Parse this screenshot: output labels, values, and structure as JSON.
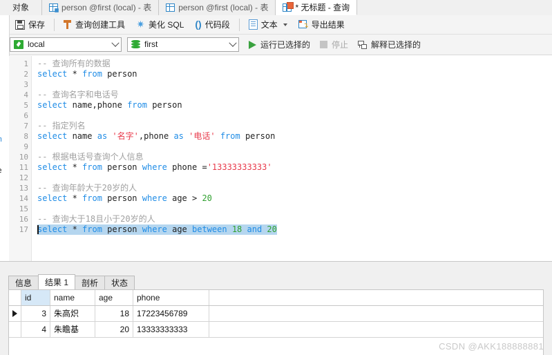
{
  "window": {
    "tabs": [
      {
        "label": "对象",
        "icon": "none",
        "state": "inactive"
      },
      {
        "label": "person @first (local) - 表",
        "icon": "table-edit-icon",
        "state": "inactive"
      },
      {
        "label": "person @first (local) - 表",
        "icon": "table-icon",
        "state": "inactive"
      },
      {
        "label": "* 无标题 - 查询",
        "icon": "query-icon",
        "state": "active"
      }
    ]
  },
  "toolbar": {
    "save_label": "保存",
    "query_builder_label": "查询创建工具",
    "beautify_label": "美化 SQL",
    "snippet_label": "代码段",
    "text_label": "文本",
    "export_label": "导出结果"
  },
  "selectors": {
    "connection_value": "local",
    "database_value": "first",
    "run_selected_label": "运行已选择的",
    "stop_label": "停止",
    "explain_selected_label": "解释已选择的"
  },
  "editor": {
    "lines": [
      {
        "n": "1",
        "tokens": [
          {
            "t": "cmt",
            "v": "-- 查询所有的数据"
          }
        ]
      },
      {
        "n": "2",
        "tokens": [
          {
            "t": "kw",
            "v": "select"
          },
          {
            "t": "op",
            "v": " * "
          },
          {
            "t": "kw",
            "v": "from"
          },
          {
            "t": "id",
            "v": " person"
          }
        ]
      },
      {
        "n": "3",
        "tokens": []
      },
      {
        "n": "4",
        "tokens": [
          {
            "t": "cmt",
            "v": "-- 查询名字和电话号"
          }
        ]
      },
      {
        "n": "5",
        "tokens": [
          {
            "t": "kw",
            "v": "select"
          },
          {
            "t": "id",
            "v": " name"
          },
          {
            "t": "op",
            "v": ","
          },
          {
            "t": "id",
            "v": "phone "
          },
          {
            "t": "kw",
            "v": "from"
          },
          {
            "t": "id",
            "v": " person"
          }
        ]
      },
      {
        "n": "6",
        "tokens": []
      },
      {
        "n": "7",
        "tokens": [
          {
            "t": "cmt",
            "v": "-- 指定列名"
          }
        ]
      },
      {
        "n": "8",
        "tokens": [
          {
            "t": "kw",
            "v": "select"
          },
          {
            "t": "id",
            "v": " name "
          },
          {
            "t": "kw",
            "v": "as"
          },
          {
            "t": "op",
            "v": " "
          },
          {
            "t": "str",
            "v": "'名字'"
          },
          {
            "t": "op",
            "v": ","
          },
          {
            "t": "id",
            "v": "phone "
          },
          {
            "t": "kw",
            "v": "as"
          },
          {
            "t": "op",
            "v": " "
          },
          {
            "t": "str",
            "v": "'电话'"
          },
          {
            "t": "op",
            "v": " "
          },
          {
            "t": "kw",
            "v": "from"
          },
          {
            "t": "id",
            "v": " person"
          }
        ]
      },
      {
        "n": "9",
        "tokens": []
      },
      {
        "n": "10",
        "tokens": [
          {
            "t": "cmt",
            "v": "-- 根据电话号查询个人信息"
          }
        ]
      },
      {
        "n": "11",
        "tokens": [
          {
            "t": "kw",
            "v": "select"
          },
          {
            "t": "op",
            "v": " * "
          },
          {
            "t": "kw",
            "v": "from"
          },
          {
            "t": "id",
            "v": " person "
          },
          {
            "t": "kw",
            "v": "where"
          },
          {
            "t": "id",
            "v": " phone "
          },
          {
            "t": "op",
            "v": "="
          },
          {
            "t": "str",
            "v": "'13333333333'"
          }
        ]
      },
      {
        "n": "12",
        "tokens": []
      },
      {
        "n": "13",
        "tokens": [
          {
            "t": "cmt",
            "v": "-- 查询年龄大于20岁的人"
          }
        ]
      },
      {
        "n": "14",
        "tokens": [
          {
            "t": "kw",
            "v": "select"
          },
          {
            "t": "op",
            "v": " * "
          },
          {
            "t": "kw",
            "v": "from"
          },
          {
            "t": "id",
            "v": " person "
          },
          {
            "t": "kw",
            "v": "where"
          },
          {
            "t": "id",
            "v": " age "
          },
          {
            "t": "op",
            "v": "> "
          },
          {
            "t": "num",
            "v": "20"
          }
        ]
      },
      {
        "n": "15",
        "tokens": []
      },
      {
        "n": "16",
        "tokens": [
          {
            "t": "cmt",
            "v": "-- 查询大于18且小于20岁的人"
          }
        ]
      },
      {
        "n": "17",
        "selected": true,
        "tokens": [
          {
            "t": "kw",
            "v": "select"
          },
          {
            "t": "op",
            "v": " * "
          },
          {
            "t": "kw",
            "v": "from"
          },
          {
            "t": "id",
            "v": " person "
          },
          {
            "t": "kw",
            "v": "where"
          },
          {
            "t": "id",
            "v": " age "
          },
          {
            "t": "kw",
            "v": "between"
          },
          {
            "t": "op",
            "v": " "
          },
          {
            "t": "num",
            "v": "18"
          },
          {
            "t": "op",
            "v": " "
          },
          {
            "t": "kw",
            "v": "and"
          },
          {
            "t": "op",
            "v": " "
          },
          {
            "t": "num",
            "v": "20"
          }
        ]
      }
    ],
    "sliver_left": {
      "line_a": "m",
      "line_b": "e"
    }
  },
  "results": {
    "tabs": [
      {
        "label": "信息",
        "active": false
      },
      {
        "label": "结果 1",
        "active": true
      },
      {
        "label": "剖析",
        "active": false
      },
      {
        "label": "状态",
        "active": false
      }
    ],
    "columns": [
      "id",
      "name",
      "age",
      "phone"
    ],
    "rows": [
      {
        "current": true,
        "id": "3",
        "name": "朱高炽",
        "age": "18",
        "phone": "17223456789"
      },
      {
        "current": false,
        "id": "4",
        "name": "朱瞻基",
        "age": "20",
        "phone": "13333333333"
      }
    ]
  },
  "watermark": {
    "text": "CSDN @AKK188888881"
  },
  "colors": {
    "keyword": "#1f8ce6",
    "string": "#e8394a",
    "number": "#2fa02f",
    "comment": "#a0a0a0",
    "selection": "#b5d6ef",
    "accent_green": "#3aa23f"
  }
}
